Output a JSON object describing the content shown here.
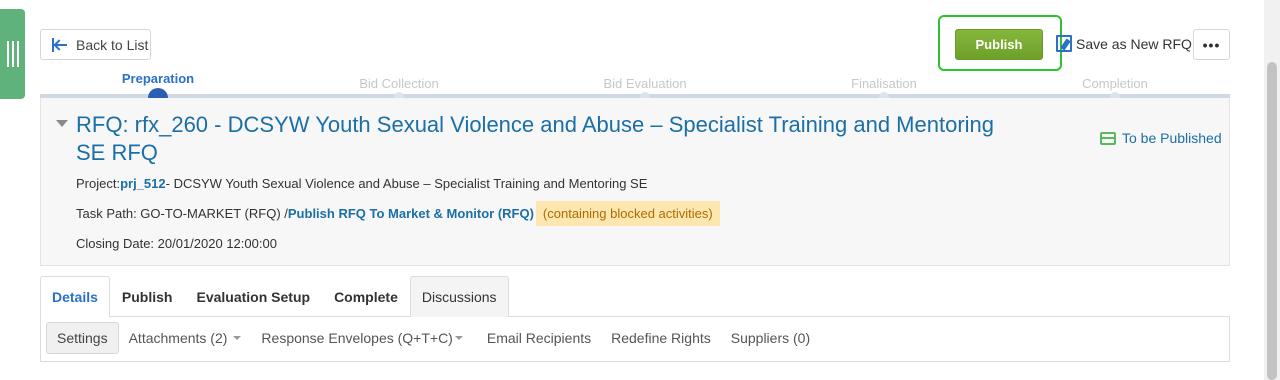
{
  "header": {
    "back_label": "Back to List",
    "publish_label": "Publish",
    "save_new_label": "Save as New RFQ",
    "more_label": "•••"
  },
  "stepper": {
    "steps": [
      {
        "label": "Preparation",
        "active": true
      },
      {
        "label": "Bid Collection",
        "active": false
      },
      {
        "label": "Bid Evaluation",
        "active": false
      },
      {
        "label": "Finalisation",
        "active": false
      },
      {
        "label": "Completion",
        "active": false
      }
    ]
  },
  "rfq": {
    "title": "RFQ: rfx_260 - DCSYW Youth Sexual Violence and Abuse – Specialist Training and Mentoring SE RFQ",
    "status": "To be Published",
    "project_label": "Project:",
    "project_id": "prj_512",
    "project_name": "- DCSYW Youth Sexual Violence and Abuse – Specialist Training and Mentoring SE",
    "task_path_label": "Task Path: GO-TO-MARKET (RFQ) /",
    "task_path_link": "Publish RFQ To Market & Monitor (RFQ)",
    "blocked_note": "(containing blocked activities)",
    "closing_date": "Closing Date: 20/01/2020 12:00:00"
  },
  "tabs": [
    {
      "label": "Details",
      "active": true
    },
    {
      "label": "Publish",
      "active": false
    },
    {
      "label": "Evaluation Setup",
      "active": false
    },
    {
      "label": "Complete",
      "active": false
    },
    {
      "label": "Discussions",
      "active": false
    }
  ],
  "subtabs": [
    {
      "label": "Settings",
      "active": true
    },
    {
      "label": "Attachments (2)",
      "dropdown": true
    },
    {
      "label": "Response Envelopes (Q+T+C)",
      "dropdown": true
    },
    {
      "label": "Email Recipients"
    },
    {
      "label": "Redefine Rights"
    },
    {
      "label": "Suppliers (0)"
    }
  ],
  "colors": {
    "accent": "#2a72c7",
    "title": "#1b6fa6",
    "publish": "#7aab34",
    "highlight": "#2ec22e",
    "blocked_bg": "#fce7b0"
  }
}
